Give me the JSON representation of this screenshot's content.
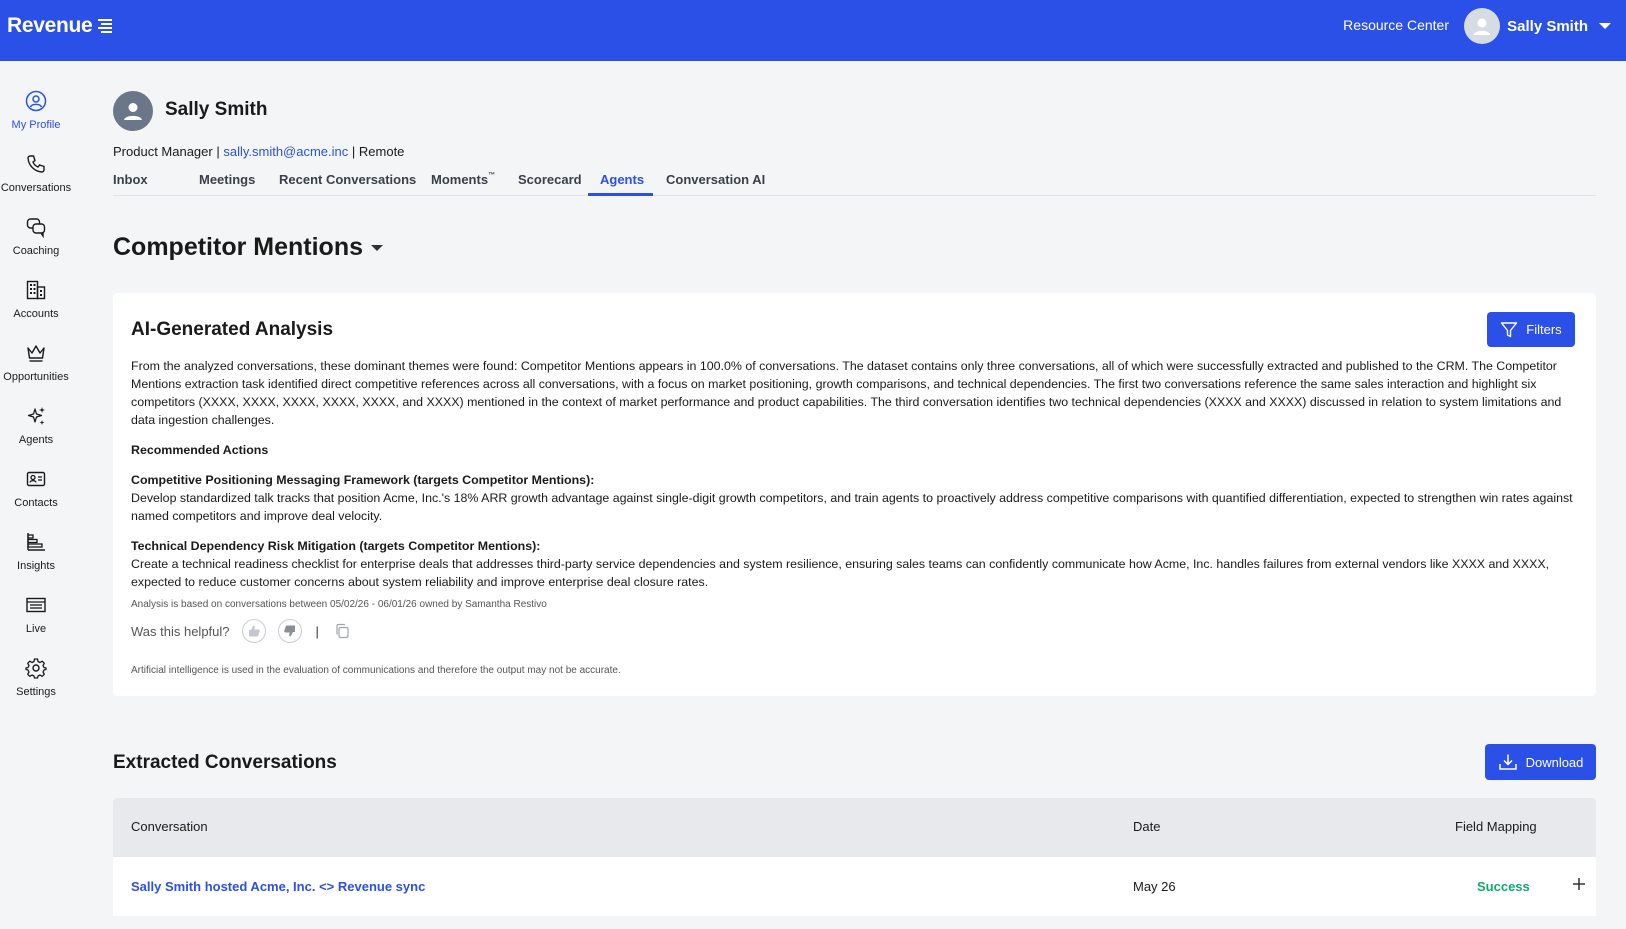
{
  "app": {
    "logo_text": "Revenue"
  },
  "topbar": {
    "resource_center": "Resource Center",
    "user_name": "Sally Smith"
  },
  "sidebar": {
    "items": [
      {
        "label": "My Profile",
        "icon": "user-circle-icon",
        "active": true
      },
      {
        "label": "Conversations",
        "icon": "phone-icon"
      },
      {
        "label": "Coaching",
        "icon": "chat-bubbles-icon"
      },
      {
        "label": "Accounts",
        "icon": "building-icon"
      },
      {
        "label": "Opportunities",
        "icon": "crown-icon"
      },
      {
        "label": "Agents",
        "icon": "sparkles-icon"
      },
      {
        "label": "Contacts",
        "icon": "contact-card-icon"
      },
      {
        "label": "Insights",
        "icon": "bar-chart-icon"
      },
      {
        "label": "Live",
        "icon": "live-list-icon"
      },
      {
        "label": "Settings",
        "icon": "gear-icon"
      }
    ]
  },
  "profile": {
    "name": "Sally Smith",
    "role": "Product Manager",
    "email": "sally.smith@acme.inc",
    "location": "Remote"
  },
  "tabs": [
    {
      "label": "Inbox"
    },
    {
      "label": "Meetings"
    },
    {
      "label": "Recent Conversations"
    },
    {
      "label": "Moments",
      "sup": "™"
    },
    {
      "label": "Scorecard"
    },
    {
      "label": "Agents",
      "active": true
    },
    {
      "label": "Conversation AI"
    }
  ],
  "agent": {
    "title": "Competitor Mentions"
  },
  "analysis": {
    "title": "AI-Generated Analysis",
    "filters_label": "Filters",
    "summary": "From the analyzed conversations, these dominant themes were found: Competitor Mentions appears in 100.0% of conversations. The dataset contains only three conversations, all of which were successfully extracted and published to the CRM. The Competitor Mentions extraction task identified direct competitive references across all conversations, with a focus on market positioning, growth comparisons, and technical dependencies. The first two conversations reference the same sales interaction and highlight six competitors (XXXX, XXXX, XXXX, XXXX, XXXX, and XXXX) mentioned in the context of market performance and product capabilities. The third conversation identifies two technical dependencies (XXXX and XXXX) discussed in relation to system limitations and data ingestion challenges.",
    "recommended_heading": "Recommended Actions",
    "actions": [
      {
        "title": "Competitive Positioning Messaging Framework (targets Competitor Mentions):",
        "body": "Develop standardized talk tracks that position Acme, Inc.'s 18% ARR growth advantage against single-digit growth competitors, and train agents to proactively address competitive comparisons with quantified differentiation, expected to strengthen win rates against named competitors and improve deal velocity."
      },
      {
        "title": "Technical Dependency Risk Mitigation (targets Competitor Mentions):",
        "body": "Create a technical readiness checklist for enterprise deals that addresses third-party service dependencies and system resilience, ensuring sales teams can confidently communicate how Acme, Inc. handles failures from external vendors like XXXX and XXXX, expected to reduce customer concerns about system reliability and improve enterprise deal closure rates."
      }
    ],
    "basis_note": "Analysis is based on conversations between 05/02/26 - 06/01/26 owned by Samantha Restivo",
    "helpful_prompt": "Was this helpful?",
    "separator": "|",
    "disclaimer": "Artificial intelligence is used in the evaluation of communications and therefore the output may not be accurate."
  },
  "extracted": {
    "title": "Extracted Conversations",
    "download_label": "Download",
    "columns": {
      "conversation": "Conversation",
      "date": "Date",
      "field_mapping": "Field Mapping"
    },
    "rows": [
      {
        "conversation": "Sally Smith hosted Acme, Inc. <> Revenue sync",
        "date": "May 26",
        "field_mapping": "Success"
      }
    ]
  },
  "colors": {
    "brand": "#2b50e8",
    "success": "#12a86b"
  }
}
